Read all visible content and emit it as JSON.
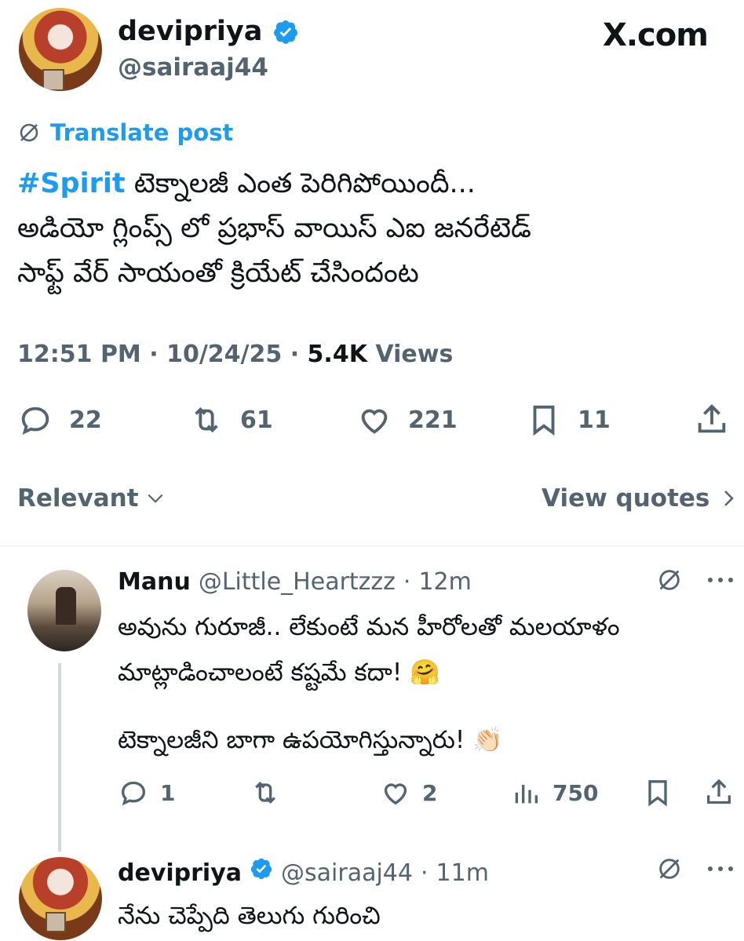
{
  "watermark": "X.com",
  "post": {
    "author_name": "devipriya",
    "author_handle": "@sairaaj44",
    "translate_label": "Translate post",
    "hashtag": "#Spirit",
    "text_line1": " టెక్నాలజీ ఎంత పెరిగిపోయిందీ...",
    "text_line2": "అడియో గ్లింప్స్ లో ప్రభాస్ వాయిస్ ఎఐ జనరేటెడ్",
    "text_line3": "సాఫ్ట్ వేర్ సాయంతో క్రియేట్ చేసిందంట",
    "time": "12:51 PM",
    "date": "10/24/25",
    "views_count": "5.4K",
    "views_label": "Views",
    "replies": "22",
    "reposts": "61",
    "likes": "221",
    "bookmarks": "11"
  },
  "sort": {
    "label": "Relevant",
    "view_quotes": "View quotes"
  },
  "replies": [
    {
      "name": "Manu",
      "handle": "@Little_Heartzzz",
      "time": "12m",
      "text1": "అవును గురూజీ.. లేకుంటే మన హీరోలతో మలయాళం",
      "text2": "మాట్లాడించాలంటే కష్టమే కదా! 🤗",
      "text3": "టెక్నాలజీని బాగా ఉపయోగిస్తున్నారు! 👏🏻",
      "replies": "1",
      "reposts": "",
      "likes": "2",
      "views": "750"
    },
    {
      "name": "devipriya",
      "handle": "@sairaaj44",
      "time": "11m",
      "text1": "నేను చెప్పేది తెలుగు గురించి"
    }
  ],
  "colors": {
    "accent": "#1d9bf0",
    "text": "#0f1419",
    "secondary": "#536471",
    "divider": "#e6ecf0"
  }
}
